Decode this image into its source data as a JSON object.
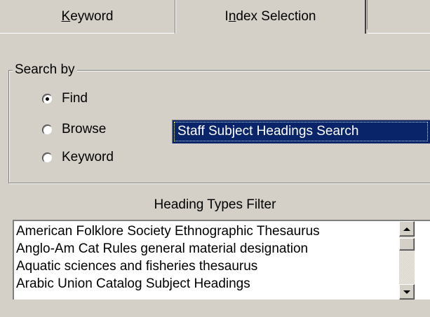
{
  "tabs": {
    "keyword": {
      "prefix": "",
      "accel": "K",
      "suffix": "eyword"
    },
    "index_selection": {
      "prefix": "I",
      "accel": "n",
      "suffix": "dex Selection"
    }
  },
  "search_by": {
    "legend": "Search by",
    "options": [
      {
        "label": "Find",
        "checked": true
      },
      {
        "label": "Browse",
        "checked": false
      },
      {
        "label": "Keyword",
        "checked": false
      }
    ],
    "selected_index": "Staff Subject Headings Search"
  },
  "filter": {
    "label": "Heading Types Filter",
    "items": [
      "American Folklore Society Ethnographic Thesaurus",
      "Anglo-Am Cat Rules general material designation",
      "Aquatic sciences and fisheries thesaurus",
      "Arabic Union Catalog Subject Headings"
    ]
  },
  "colors": {
    "face": "#d4d0c8",
    "highlight": "#0a246a"
  },
  "icons": {
    "scroll_up": "arrow-up-icon",
    "scroll_down": "arrow-down-icon"
  }
}
